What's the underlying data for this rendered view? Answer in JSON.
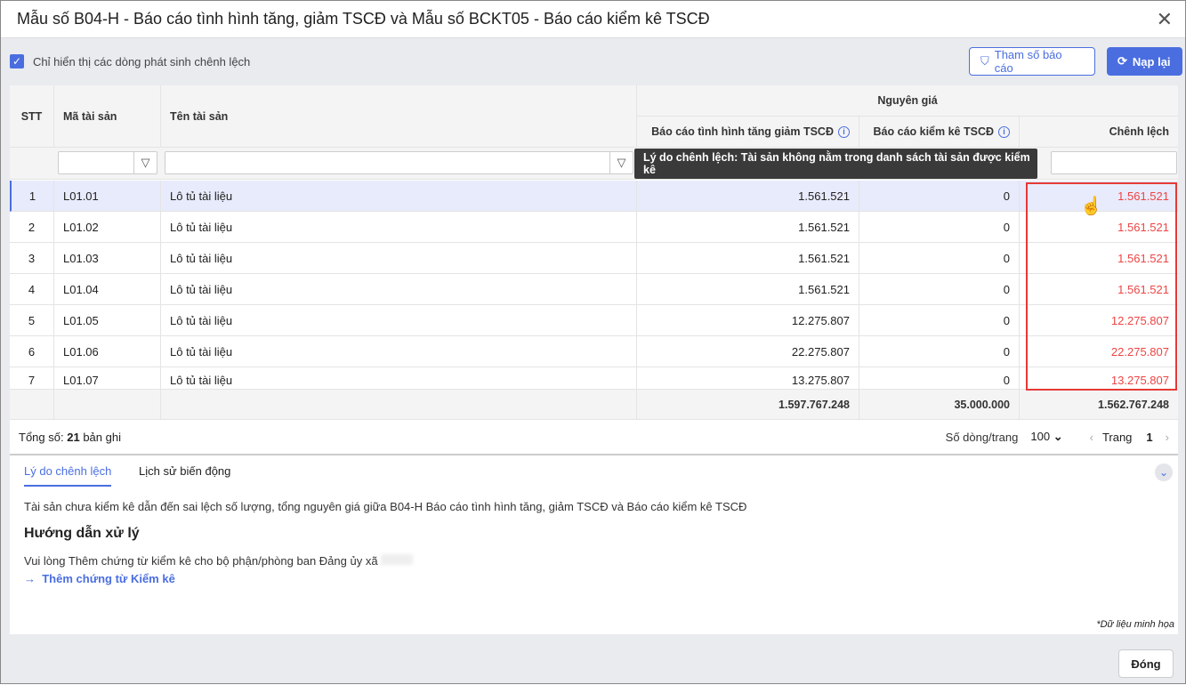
{
  "title": "Mẫu số B04-H - Báo cáo tình hình tăng, giảm TSCĐ và Mẫu số BCKT05 - Báo cáo kiểm kê TSCĐ",
  "toolbar": {
    "checkbox_label": "Chỉ hiển thị các dòng phát sinh chênh lệch",
    "checked": true,
    "params_label": "Tham số báo cáo",
    "reload_label": "Nạp lại"
  },
  "columns": {
    "stt": "STT",
    "code": "Mã tài sản",
    "name": "Tên tài sản",
    "group": "Nguyên giá",
    "report": "Báo cáo tình hình tăng giảm TSCĐ",
    "inventory": "Báo cáo kiểm kê TSCĐ",
    "diff": "Chênh lệch"
  },
  "tooltip": "Lý do chênh lệch: Tài sản không nằm trong danh sách tài sản được kiểm kê",
  "rows": [
    {
      "stt": "1",
      "code": "L01.01",
      "name": "Lô tủ tài liệu",
      "report": "1.561.521",
      "inventory": "0",
      "diff": "1.561.521"
    },
    {
      "stt": "2",
      "code": "L01.02",
      "name": "Lô tủ tài liệu",
      "report": "1.561.521",
      "inventory": "0",
      "diff": "1.561.521"
    },
    {
      "stt": "3",
      "code": "L01.03",
      "name": "Lô tủ tài liệu",
      "report": "1.561.521",
      "inventory": "0",
      "diff": "1.561.521"
    },
    {
      "stt": "4",
      "code": "L01.04",
      "name": "Lô tủ tài liệu",
      "report": "1.561.521",
      "inventory": "0",
      "diff": "1.561.521"
    },
    {
      "stt": "5",
      "code": "L01.05",
      "name": "Lô tủ tài liệu",
      "report": "12.275.807",
      "inventory": "0",
      "diff": "12.275.807"
    },
    {
      "stt": "6",
      "code": "L01.06",
      "name": "Lô tủ tài liệu",
      "report": "22.275.807",
      "inventory": "0",
      "diff": "22.275.807"
    },
    {
      "stt": "7",
      "code": "L01.07",
      "name": "Lô tủ tài liệu",
      "report": "13.275.807",
      "inventory": "0",
      "diff": "13.275.807"
    }
  ],
  "totals": {
    "report": "1.597.767.248",
    "inventory": "35.000.000",
    "diff": "1.562.767.248"
  },
  "footer": {
    "total_prefix": "Tổng số:",
    "total_count": "21",
    "total_suffix": "bản ghi",
    "page_size_label": "Số dòng/trang",
    "page_size": "100",
    "page_label": "Trang",
    "page": "1"
  },
  "detail": {
    "tabs": [
      "Lý do chênh lệch",
      "Lịch sử biến động"
    ],
    "reason": "Tài sản chưa kiểm kê dẫn đến sai lệch số lượng, tổng nguyên giá giữa B04-H Báo cáo tình hình tăng, giảm TSCĐ và Báo cáo kiểm kê TSCĐ",
    "guide_title": "Hướng dẫn xử lý",
    "guide_text": "Vui lòng Thêm chứng từ kiểm kê cho bộ phận/phòng ban Đảng ủy xã",
    "guide_link": "Thêm chứng từ Kiểm kê",
    "note": "*Dữ liệu minh họa"
  },
  "close_label": "Đóng"
}
